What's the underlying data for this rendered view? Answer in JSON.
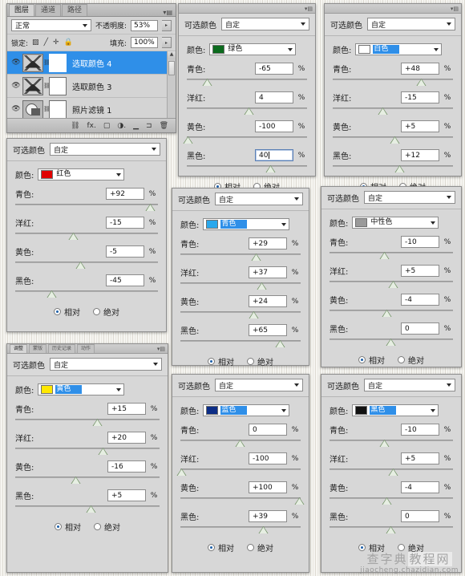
{
  "layers_panel": {
    "tabs": [
      {
        "label": "图层",
        "selected": true
      },
      {
        "label": "通道",
        "selected": false
      },
      {
        "label": "路径",
        "selected": false
      }
    ],
    "menu_icon": "panel-menu-icon",
    "blend_mode": "正常",
    "opacity_label": "不透明度:",
    "opacity_value": "53%",
    "lock_label": "锁定:",
    "lock_icons": [
      "transparency-lock-icon",
      "brush-lock-icon",
      "move-lock-icon",
      "all-lock-icon"
    ],
    "fill_label": "填充:",
    "fill_value": "100%",
    "layers": [
      {
        "name": "选取颜色 4",
        "selected": true,
        "thumb": "curves-adjustment-icon"
      },
      {
        "name": "选取颜色 3",
        "selected": false,
        "thumb": "curves-adjustment-icon"
      },
      {
        "name": "照片滤镜 1",
        "selected": false,
        "thumb": "photo-filter-icon"
      }
    ],
    "bottom_icons": [
      "link-icon",
      "fx-icon",
      "mask-icon",
      "adjustment-icon",
      "group-icon",
      "new-layer-icon",
      "delete-icon"
    ]
  },
  "common": {
    "preset_label": "可选颜色",
    "preset_value": "自定",
    "color_label": "颜色:",
    "cyan_label": "青色:",
    "magenta_label": "洋红:",
    "yellow_label": "黄色:",
    "black_label": "黑色:",
    "percent": "%",
    "relative_label": "相对",
    "absolute_label": "绝对"
  },
  "panels": [
    {
      "id": "green",
      "color_name": "绿色",
      "swatch_hex": "#0c6b1e",
      "highlight": false,
      "values": {
        "cyan": "-65",
        "magenta": "4",
        "yellow": "-100",
        "black": "40"
      },
      "slider_pct": {
        "cyan": 17.5,
        "magenta": 52.0,
        "yellow": 1.0,
        "black": 70.0
      },
      "black_focused": true,
      "mode": "relative",
      "topbar": {
        "tabs": [],
        "show": true
      }
    },
    {
      "id": "white",
      "color_name": "白色",
      "swatch_hex": "#ffffff",
      "highlight": true,
      "values": {
        "cyan": "+48",
        "magenta": "-15",
        "yellow": "+5",
        "black": "+12"
      },
      "slider_pct": {
        "cyan": 74.0,
        "magenta": 42.0,
        "yellow": 52.0,
        "black": 56.0
      },
      "black_focused": false,
      "mode": "relative",
      "topbar": {
        "tabs": [],
        "show": true
      }
    },
    {
      "id": "red",
      "color_name": "红色",
      "swatch_hex": "#e00000",
      "highlight": false,
      "values": {
        "cyan": "+92",
        "magenta": "-15",
        "yellow": "-5",
        "black": "-45"
      },
      "slider_pct": {
        "cyan": 95.0,
        "magenta": 41.0,
        "yellow": 46.0,
        "black": 26.0
      },
      "black_focused": false,
      "mode": "relative",
      "topbar": {
        "tabs": [],
        "show": false
      }
    },
    {
      "id": "cyan",
      "color_name": "青色",
      "swatch_hex": "#2aa8ec",
      "highlight": true,
      "values": {
        "cyan": "+29",
        "magenta": "+37",
        "yellow": "+24",
        "black": "+65"
      },
      "slider_pct": {
        "cyan": 63.0,
        "magenta": 68.0,
        "yellow": 61.0,
        "black": 83.0
      },
      "black_focused": false,
      "mode": "relative",
      "topbar": {
        "tabs": [],
        "show": false
      }
    },
    {
      "id": "neutral",
      "color_name": "中性色",
      "swatch_hex": "#9a9a9a",
      "highlight": false,
      "values": {
        "cyan": "-10",
        "magenta": "+5",
        "yellow": "-4",
        "black": "0"
      },
      "slider_pct": {
        "cyan": 45.0,
        "magenta": 52.0,
        "yellow": 47.0,
        "black": 50.0
      },
      "black_focused": false,
      "mode": "relative",
      "topbar": {
        "tabs": [],
        "show": true
      }
    },
    {
      "id": "yellow",
      "color_name": "黄色",
      "swatch_hex": "#ffe800",
      "highlight": true,
      "values": {
        "cyan": "+15",
        "magenta": "+20",
        "yellow": "-16",
        "black": "+5"
      },
      "slider_pct": {
        "cyan": 57.0,
        "magenta": 61.0,
        "yellow": 42.0,
        "black": 53.0
      },
      "black_focused": false,
      "mode": "relative",
      "topbar": {
        "show": true,
        "tabs": [
          {
            "label": "调整",
            "selected": true
          },
          {
            "label": "蒙版",
            "selected": false
          },
          {
            "label": "历史记录",
            "selected": false
          },
          {
            "label": "动作",
            "selected": false
          }
        ]
      }
    },
    {
      "id": "blue",
      "color_name": "蓝色",
      "swatch_hex": "#0c2d86",
      "highlight": true,
      "values": {
        "cyan": "0",
        "magenta": "-100",
        "yellow": "+100",
        "black": "+39"
      },
      "slider_pct": {
        "cyan": 50.0,
        "magenta": 1.0,
        "yellow": 99.0,
        "black": 69.0
      },
      "black_focused": false,
      "mode": "relative",
      "topbar": {
        "tabs": [],
        "show": false
      }
    },
    {
      "id": "black",
      "color_name": "黑色",
      "swatch_hex": "#111111",
      "highlight": true,
      "values": {
        "cyan": "-10",
        "magenta": "+5",
        "yellow": "-4",
        "black": "0"
      },
      "slider_pct": {
        "cyan": 45.0,
        "magenta": 52.0,
        "yellow": 47.0,
        "black": 50.0
      },
      "black_focused": false,
      "mode": "relative",
      "topbar": {
        "tabs": [],
        "show": false
      }
    }
  ],
  "watermark": {
    "cn_plain": "查字典",
    "cn_boxed": "教程网",
    "url": "jiaocheng.chazidian.com"
  }
}
